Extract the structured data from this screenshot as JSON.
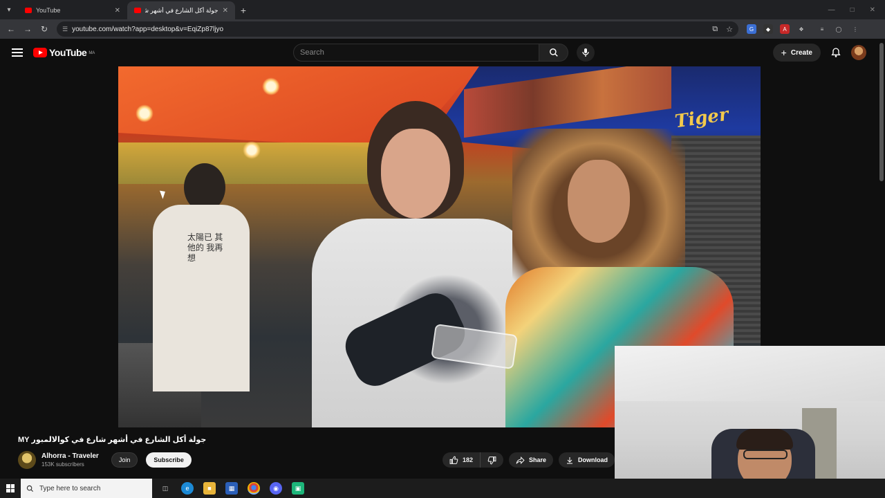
{
  "browser": {
    "tabs": [
      {
        "title": "YouTube",
        "active": false
      },
      {
        "title": "جولة أكل الشارع في أشهر شارع",
        "active": true
      }
    ],
    "url": "youtube.com/watch?app=desktop&v=EqiZp87ljyo"
  },
  "youtube": {
    "logo_text": "YouTube",
    "country_code": "MA",
    "search_placeholder": "Search",
    "create_label": "Create"
  },
  "video": {
    "title": "جولة أكل الشارع في أشهر شارع في كوالالمبور MY",
    "scene_text": {
      "sign": "Tiger",
      "shirt": "太陽已 其他的 我再想"
    },
    "channel": {
      "name": "Alhorra - Traveler",
      "subscribers": "153K subscribers"
    },
    "join_label": "Join",
    "subscribe_label": "Subscribe",
    "likes": "182",
    "share_label": "Share",
    "download_label": "Download"
  },
  "taskbar": {
    "search_placeholder": "Type here to search"
  },
  "colors": {
    "brand_red": "#ff0000",
    "background": "#0f0f0f",
    "pill_bg": "#272727"
  }
}
